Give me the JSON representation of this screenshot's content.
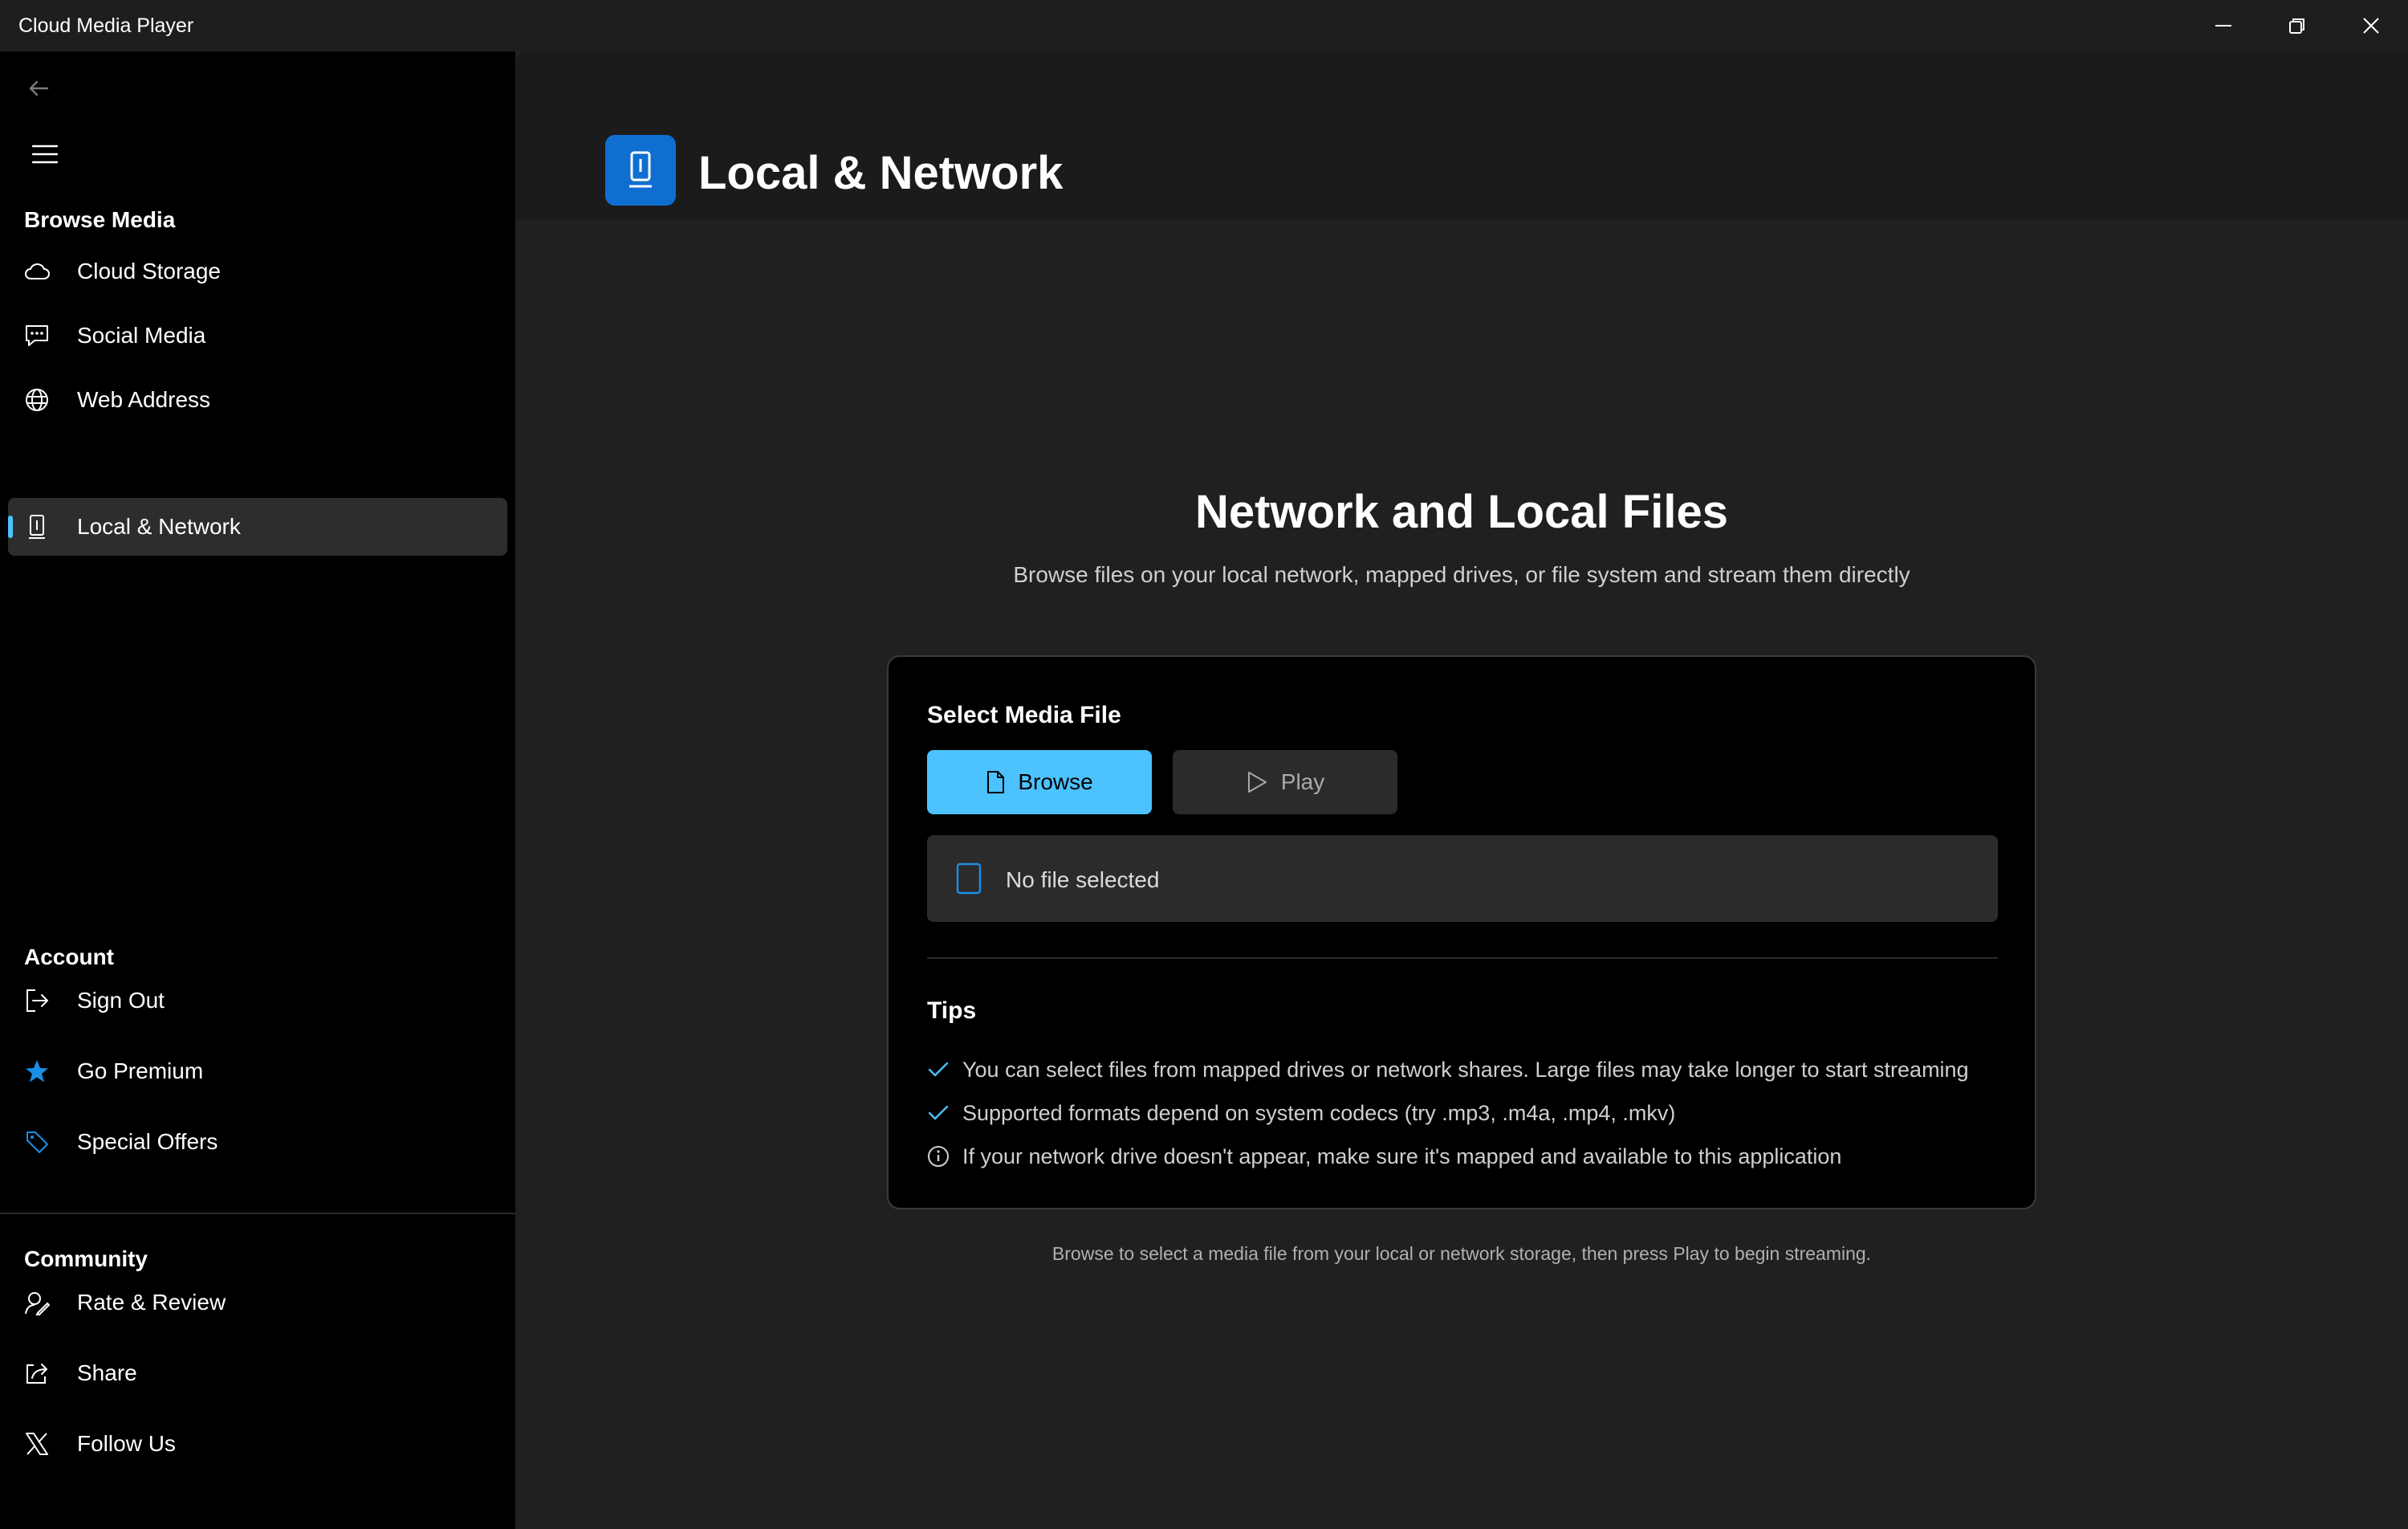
{
  "window": {
    "title": "Cloud Media Player"
  },
  "sidebar": {
    "browse_title": "Browse Media",
    "browse_items": [
      {
        "label": "Cloud Storage",
        "icon": "cloud-icon"
      },
      {
        "label": "Social Media",
        "icon": "chat-icon"
      },
      {
        "label": "Web Address",
        "icon": "globe-icon"
      },
      {
        "label": "Local & Network",
        "icon": "device-icon",
        "selected": true
      }
    ],
    "account_title": "Account",
    "account_items": [
      {
        "label": "Sign Out",
        "icon": "sign-out-icon"
      },
      {
        "label": "Go Premium",
        "icon": "star-icon"
      },
      {
        "label": "Special Offers",
        "icon": "tag-icon"
      }
    ],
    "community_title": "Community",
    "community_items": [
      {
        "label": "Rate & Review",
        "icon": "review-icon"
      },
      {
        "label": "Share",
        "icon": "share-icon"
      },
      {
        "label": "Follow Us",
        "icon": "x-logo-icon"
      }
    ]
  },
  "header": {
    "title": "Local & Network"
  },
  "hero": {
    "title": "Network and Local Files",
    "subtitle": "Browse files on your local network, mapped drives, or file system and stream them directly"
  },
  "card": {
    "title": "Select Media File",
    "browse_label": "Browse",
    "play_label": "Play",
    "file_status": "No file selected",
    "tips_title": "Tips",
    "tips": [
      {
        "text": "You can select files from mapped drives or network shares. Large files may take longer to start streaming",
        "icon": "check-icon"
      },
      {
        "text": "Supported formats depend on system codecs (try .mp3, .m4a, .mp4, .mkv)",
        "icon": "check-icon"
      },
      {
        "text": "If your network drive doesn't appear, make sure it's mapped and available to this application",
        "icon": "info-icon"
      }
    ]
  },
  "footer_note": "Browse to select a media file from your local or network storage, then press Play to begin streaming.",
  "colors": {
    "accent": "#4cc2ff",
    "header_icon_bg": "#0e6fd0",
    "premium_star": "#1a8fe6"
  }
}
